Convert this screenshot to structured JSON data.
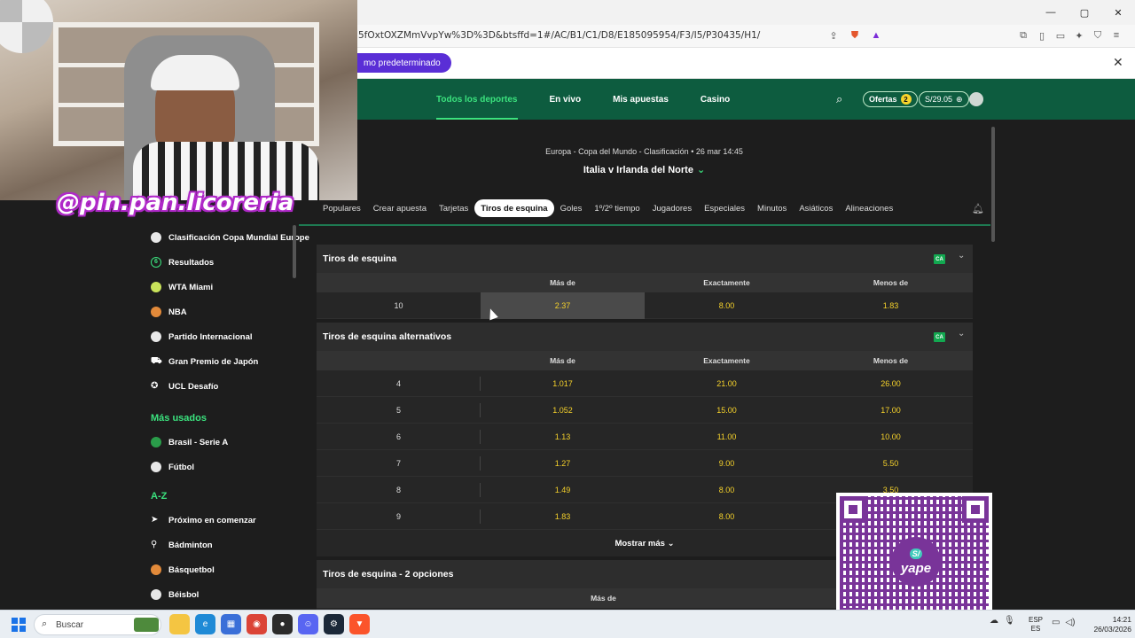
{
  "browser": {
    "url": "5fOxtOXZMmVvpYw%3D%3D&btsffd=1#/AC/B1/C1/D8/E185095954/F3/I5/P30435/H1/",
    "infobar_button": "mo predeterminado",
    "window_controls": [
      "—",
      "▢",
      "✕"
    ]
  },
  "header": {
    "nav": [
      "Todos los deportes",
      "En vivo",
      "Mis apuestas",
      "Casino"
    ],
    "ofertas_label": "Ofertas",
    "ofertas_count": "2",
    "balance": "S/29.05"
  },
  "match": {
    "competition": "Europa - Copa del Mundo - Clasificación • 26 mar 14:45",
    "teams": "Italia v Irlanda del Norte"
  },
  "tabs": [
    "Populares",
    "Crear apuesta",
    "Tarjetas",
    "Tiros de esquina",
    "Goles",
    "1º/2º tiempo",
    "Jugadores",
    "Especiales",
    "Minutos",
    "Asiáticos",
    "Alineaciones"
  ],
  "active_tab": "Tiros de esquina",
  "sidebar": {
    "top_items": [
      {
        "label": "Clasificación Copa Mundial Europe",
        "icon": "soccer-ball-icon"
      },
      {
        "label": "Resultados",
        "icon": "results-icon"
      },
      {
        "label": "WTA Miami",
        "icon": "tennis-ball-icon"
      },
      {
        "label": "NBA",
        "icon": "basketball-icon"
      },
      {
        "label": "Partido Internacional",
        "icon": "soccer-ball-icon"
      },
      {
        "label": "Gran Premio de Japón",
        "icon": "racing-car-icon"
      },
      {
        "label": "UCL Desafío",
        "icon": "ucl-icon"
      }
    ],
    "most_used_heading": "Más usados",
    "most_used": [
      {
        "label": "Brasil - Serie A",
        "icon": "brazil-flag-icon"
      },
      {
        "label": "Fútbol",
        "icon": "soccer-ball-icon"
      }
    ],
    "az_heading": "A-Z",
    "az_items": [
      {
        "label": "Próximo en comenzar",
        "icon": "arrow-icon"
      },
      {
        "label": "Bádminton",
        "icon": "shuttlecock-icon"
      },
      {
        "label": "Básquetbol",
        "icon": "basketball-icon"
      },
      {
        "label": "Béisbol",
        "icon": "baseball-icon"
      }
    ]
  },
  "markets": [
    {
      "title": "Tiros de esquina",
      "badge": "CA",
      "columns": [
        "Más de",
        "Exactamente",
        "Menos de"
      ],
      "rows": [
        {
          "line": "10",
          "over": "2.37",
          "exact": "8.00",
          "under": "1.83"
        }
      ]
    },
    {
      "title": "Tiros de esquina alternativos",
      "badge": "CA",
      "columns": [
        "Más de",
        "Exactamente",
        "Menos de"
      ],
      "rows": [
        {
          "line": "4",
          "over": "1.017",
          "exact": "21.00",
          "under": "26.00"
        },
        {
          "line": "5",
          "over": "1.052",
          "exact": "15.00",
          "under": "17.00"
        },
        {
          "line": "6",
          "over": "1.13",
          "exact": "11.00",
          "under": "10.00"
        },
        {
          "line": "7",
          "over": "1.27",
          "exact": "9.00",
          "under": "5.50"
        },
        {
          "line": "8",
          "over": "1.49",
          "exact": "8.00",
          "under": "3.50"
        },
        {
          "line": "9",
          "over": "1.83",
          "exact": "8.00",
          "under": ""
        }
      ],
      "show_more": "Mostrar más"
    },
    {
      "title": "Tiros de esquina - 2 opciones",
      "columns": [
        "Más de"
      ]
    }
  ],
  "overlay": {
    "watermark": "@pin.pan.licoreria",
    "qr_logo": "yape",
    "qr_currency": "S/"
  },
  "taskbar": {
    "search_placeholder": "Buscar",
    "lang_top": "ESP",
    "lang_bottom": "ES",
    "time": "14:21",
    "date": "26/03/2026"
  }
}
